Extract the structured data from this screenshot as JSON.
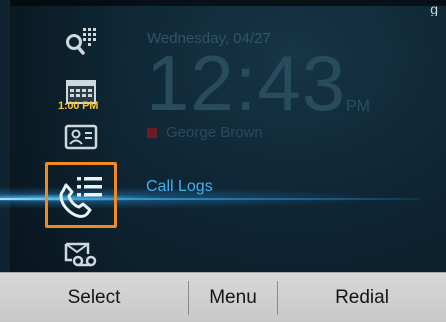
{
  "status": {
    "corner_text": "g"
  },
  "home": {
    "date": "Wednesday, 04/27",
    "time": "12:43",
    "ampm": "PM",
    "user": "George Brown"
  },
  "sidebar": {
    "calendar_time": "1:00 PM",
    "icons": [
      "search-dialpad-icon",
      "calendar-icon",
      "contacts-icon",
      "call-logs-icon",
      "voicemail-icon"
    ],
    "selected_index": 3
  },
  "menu": {
    "selected_label": "Call Logs"
  },
  "softkeys": {
    "select": "Select",
    "menu": "Menu",
    "redial": "Redial"
  },
  "colors": {
    "accent": "#3db4f0",
    "selection": "#f08a24",
    "calendar_time": "#f4c830"
  }
}
